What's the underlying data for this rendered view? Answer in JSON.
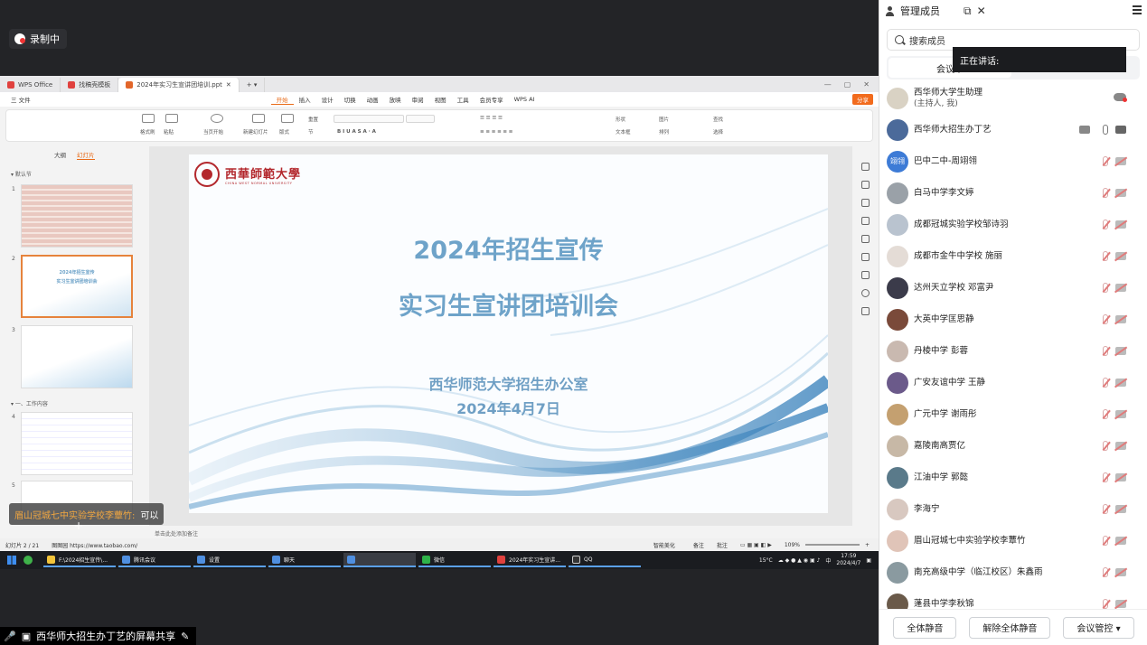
{
  "meeting": {
    "recording_label": "录制中",
    "share_label": "西华师大招生办丁艺的屏幕共享"
  },
  "wps": {
    "tabs": [
      "WPS Office",
      "找稿壳模板",
      "2024年实习生宣讲团培训.ppt"
    ],
    "menu": [
      "三 文件",
      "开始",
      "插入",
      "设计",
      "切换",
      "动画",
      "放映",
      "审阅",
      "视图",
      "工具",
      "会员专享",
      "WPS AI"
    ],
    "active_menu": "开始",
    "share_button": "分享",
    "ribbon_labels": [
      "格式刷",
      "粘贴",
      "当页开始",
      "新建幻灯片",
      "版式",
      "节",
      "重置",
      "形状",
      "图片",
      "文本框",
      "排列",
      "查找",
      "选择"
    ],
    "thumb_tabs": [
      "大纲",
      "幻灯片"
    ],
    "sections": [
      "默认节",
      "一、工作内容"
    ],
    "slide_numbers": [
      "1",
      "2",
      "3",
      "4",
      "5"
    ],
    "notes_placeholder": "单击此处添加备注",
    "status": {
      "slide_counter": "幻灯片 2 / 21",
      "theme": "图图园 https://www.taobao.com/",
      "smart_beautify": "智能美化",
      "notes": "备注",
      "comment": "批注",
      "zoom": "109%"
    }
  },
  "slide": {
    "logo_text": "西華師範大學",
    "logo_sub": "CHINA WEST NORMAL UNIVERSITY",
    "title_line1": "2024年招生宣传",
    "title_line2": "实习生宣讲团培训会",
    "org": "西华师范大学招生办公室",
    "date": "2024年4月7日"
  },
  "taskbar": {
    "items": [
      "F:\\2024招生宣传\\...",
      "腾讯会议",
      "设置",
      "聊天",
      "",
      "微信",
      "2024年实习生宣讲...",
      "QQ"
    ],
    "temp": "15°C",
    "ime": "中",
    "time": "17:59",
    "date": "2024/4/7"
  },
  "overlay_tip": {
    "who": "眉山冠城七中实验学校李蕈竹:",
    "msg": "可以"
  },
  "panel": {
    "title": "管理成员",
    "search_placeholder": "搜索成员",
    "segment": "会议中",
    "speaking": "正在讲话:",
    "buttons": [
      "全体静音",
      "解除全体静音",
      "会议管控 ▾"
    ],
    "members": [
      {
        "name": "西华师大学生助理",
        "sub": "(主持人, 我)",
        "avatar": "",
        "color": "#d9d2c4",
        "mic": "none",
        "cam": "cloud"
      },
      {
        "name": "西华师大招生办丁艺",
        "sub": "",
        "avatar": "",
        "color": "#4b6a9a",
        "mic": "on",
        "cam": "on",
        "screen": true
      },
      {
        "name": "巴中二中-周翊翎",
        "sub": "",
        "avatar": "翊翎",
        "color": "#3d7bd6",
        "mic": "off",
        "cam": "off"
      },
      {
        "name": "白马中学李文婷",
        "sub": "",
        "avatar": "",
        "color": "#9aa1a8",
        "mic": "off",
        "cam": "off"
      },
      {
        "name": "成都冠城实验学校邹诗羽",
        "sub": "",
        "avatar": "",
        "color": "#b9c3cf",
        "mic": "off",
        "cam": "off"
      },
      {
        "name": "成都市金牛中学校 施丽",
        "sub": "",
        "avatar": "",
        "color": "#e4dcd6",
        "mic": "off",
        "cam": "off"
      },
      {
        "name": "达州天立学校 邓富尹",
        "sub": "",
        "avatar": "",
        "color": "#3b3b4a",
        "mic": "off",
        "cam": "off"
      },
      {
        "name": "大英中学匡思静",
        "sub": "",
        "avatar": "",
        "color": "#7a4a3a",
        "mic": "off",
        "cam": "off"
      },
      {
        "name": "丹棱中学 彭蓉",
        "sub": "",
        "avatar": "",
        "color": "#c9b9b0",
        "mic": "off",
        "cam": "off"
      },
      {
        "name": "广安友谊中学 王静",
        "sub": "",
        "avatar": "",
        "color": "#6b5a8a",
        "mic": "off",
        "cam": "off"
      },
      {
        "name": "广元中学 谢雨彤",
        "sub": "",
        "avatar": "",
        "color": "#c4a070",
        "mic": "off",
        "cam": "off"
      },
      {
        "name": "嘉陵南高贾亿",
        "sub": "",
        "avatar": "",
        "color": "#c7b8a6",
        "mic": "off",
        "cam": "off"
      },
      {
        "name": "江油中学 郭懿",
        "sub": "",
        "avatar": "",
        "color": "#5a7a8a",
        "mic": "off",
        "cam": "off"
      },
      {
        "name": "李海宁",
        "sub": "",
        "avatar": "",
        "color": "#d8c8c0",
        "mic": "off",
        "cam": "off"
      },
      {
        "name": "眉山冠城七中实验学校李蕈竹",
        "sub": "",
        "avatar": "",
        "color": "#e0c4b8",
        "mic": "off",
        "cam": "off"
      },
      {
        "name": "南充高级中学（临江校区）朱鑫雨",
        "sub": "",
        "avatar": "",
        "color": "#8a9aa0",
        "mic": "off",
        "cam": "off"
      },
      {
        "name": "蓬县中学李秋锦",
        "sub": "",
        "avatar": "",
        "color": "#6a5a4a",
        "mic": "off",
        "cam": "off"
      }
    ]
  }
}
